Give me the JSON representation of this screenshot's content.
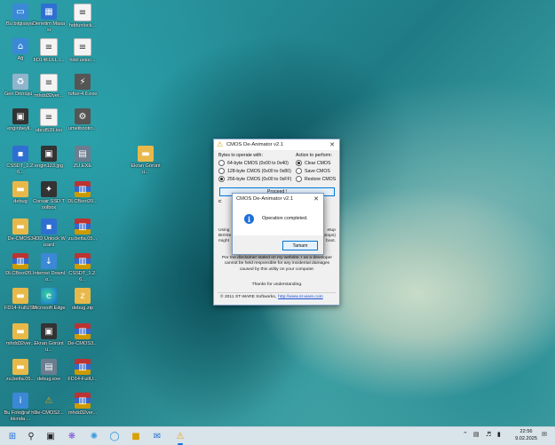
{
  "desktop_icons": [
    {
      "label": "Bu bilgisayar",
      "icon": "computer-icon"
    },
    {
      "label": "Denetim Masası",
      "icon": "control-panel-icon"
    },
    {
      "label": "hddunlock...",
      "icon": "file-icon"
    },
    {
      "label": "AnyDesk.exe",
      "icon": "anydesk-icon"
    },
    {
      "label": "Ağ",
      "icon": "network-icon"
    },
    {
      "label": "FD14FULL.l...",
      "icon": "file-icon"
    },
    {
      "label": "hdd-unloc...",
      "icon": "file-icon"
    },
    {
      "label": "Geri Dönüşü...",
      "icon": "recycle-bin-icon"
    },
    {
      "label": "mhdd32ver...",
      "icon": "file-icon"
    },
    {
      "label": "rufus-4.6.exe",
      "icon": "usb-icon"
    },
    {
      "label": "enginbeyll...",
      "icon": "image-icon"
    },
    {
      "label": "ubcd539.iso",
      "icon": "file-icon"
    },
    {
      "label": "umetbootin...",
      "icon": "tool-icon"
    },
    {
      "label": "CSSDT_1.2.6...",
      "icon": "app-icon"
    },
    {
      "label": "engin123.jpg",
      "icon": "image-icon"
    },
    {
      "label": "ZU.EXE",
      "icon": "exe-icon"
    },
    {
      "label": "Ekran Görüntü...",
      "icon": "folder-icon"
    },
    {
      "label": "debug",
      "icon": "folder-icon"
    },
    {
      "label": "Corsair SSD Toolbox",
      "icon": "corsair-icon"
    },
    {
      "label": "DLCBoot20...",
      "icon": "archive-icon"
    },
    {
      "label": "De-CMOS3",
      "icon": "folder-icon"
    },
    {
      "label": "HDD Unlock Wizard",
      "icon": "app-icon"
    },
    {
      "label": "zu.betta.05...",
      "icon": "archive-icon"
    },
    {
      "label": "DLCBoot20...",
      "icon": "archive-icon"
    },
    {
      "label": "Internet Downlo...",
      "icon": "download-icon"
    },
    {
      "label": "CSSDT_1.2.6...",
      "icon": "archive-icon"
    },
    {
      "label": "FD14-FullUSB",
      "icon": "folder-icon"
    },
    {
      "label": "Microsoft Edge",
      "icon": "edge-icon"
    },
    {
      "label": "debug.zip",
      "icon": "zip-icon"
    },
    {
      "label": "mhdd32ver...",
      "icon": "folder-icon"
    },
    {
      "label": "Ekran Görüntü...",
      "icon": "image-icon"
    },
    {
      "label": "De-CMOS3...",
      "icon": "archive-icon"
    },
    {
      "label": "zu.betta.05...",
      "icon": "folder-icon"
    },
    {
      "label": "debug.exe",
      "icon": "exe-icon"
    },
    {
      "label": "FD14-FullU...",
      "icon": "archive-icon"
    },
    {
      "label": "Bu Fotoğraf hakkında ...",
      "icon": "info-icon"
    },
    {
      "label": "De-CMOS2...",
      "icon": "warning-icon"
    },
    {
      "label": "mhdd32ver...",
      "icon": "archive-icon"
    }
  ],
  "main_window": {
    "title": "CMOS De-Animator v2.1",
    "bytes_heading": "Bytes to operate with:",
    "bytes_options": [
      "64-byte CMOS (0x00 to 0x40)",
      "128-byte CMOS (0x00 to 0x80)",
      "256-byte CMOS (0x00 to 0xFF)"
    ],
    "bytes_selected": 2,
    "action_heading": "Action to perform:",
    "action_options": [
      "Clear CMOS",
      "Save CMOS",
      "Restore CMOS"
    ],
    "action_selected": 0,
    "proceed_label": "Proceed !",
    "partial_left_lines": [
      "Using",
      "BIOSe",
      "might"
    ],
    "partial_right_lines": [
      "etup",
      "ptops)",
      "boot."
    ],
    "partial_heading": "C",
    "disclaimer": "Per the disclaimer stated on my website, I as a developer cannot be held responsible for any incidental damages caused by this utility on your computer.",
    "thanks": "Thanks for understanding.",
    "copyright": "© 2011 ST-WARE Softworks,",
    "website": "http://www.st-ware.com"
  },
  "popup": {
    "title": "CMOS De-Animator v2.1",
    "message": "Operation completed.",
    "ok_label": "Tamam"
  },
  "taskbar": {
    "time": "22:56",
    "date": "9.02.2025",
    "apps": [
      "search-icon",
      "task-view-icon",
      "widgets-icon",
      "copilot-icon",
      "edge-icon",
      "file-explorer-icon",
      "mail-icon",
      "windows-icon",
      "cmos-app-icon"
    ]
  }
}
